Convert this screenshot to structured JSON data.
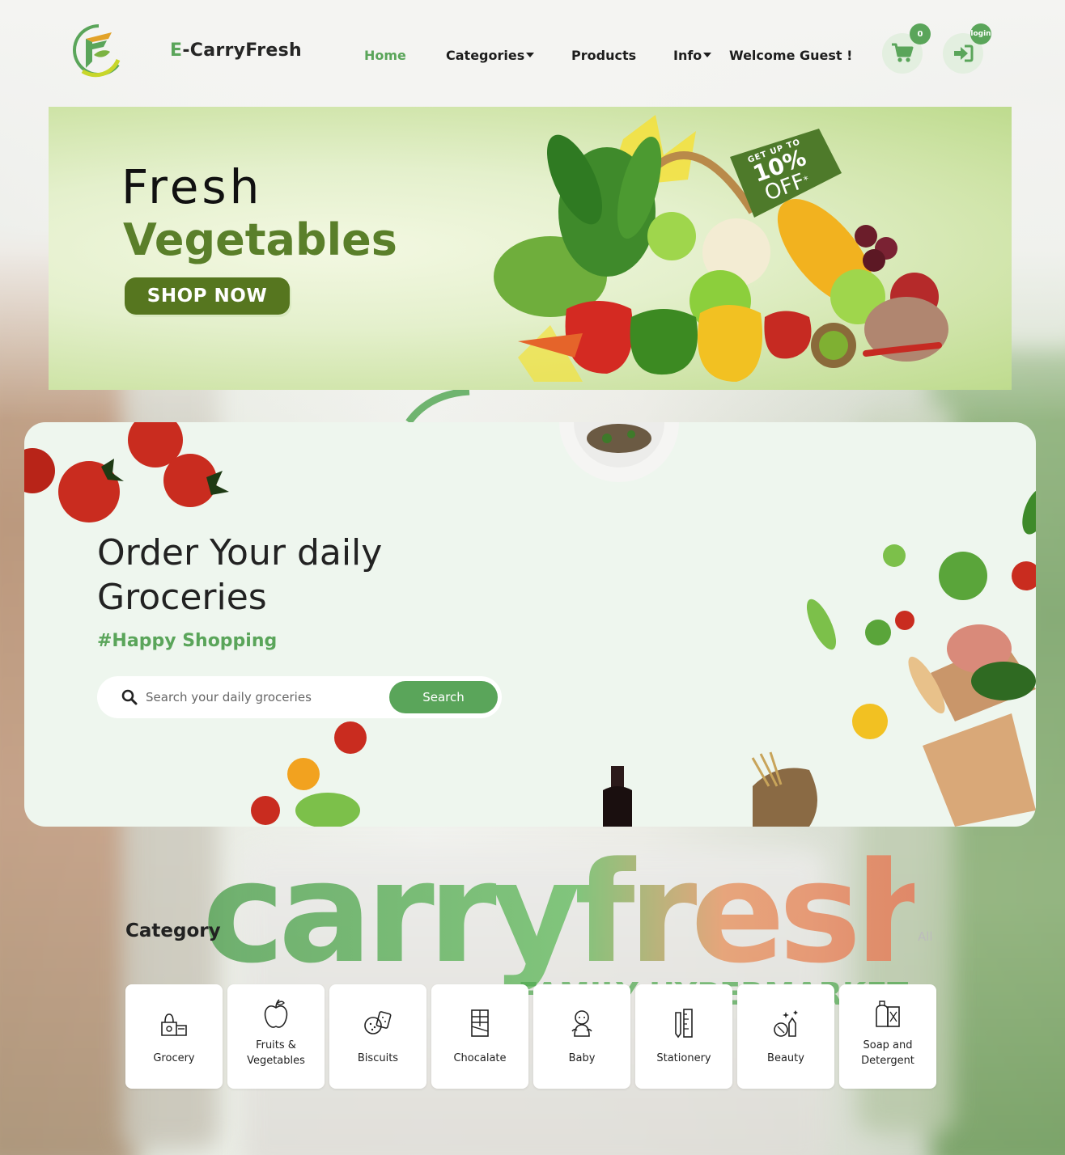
{
  "brand": {
    "prefix": "E",
    "rest": "-CarryFresh"
  },
  "nav": {
    "home": "Home",
    "categories": "Categories",
    "products": "Products",
    "info": "Info",
    "welcome": "Welcome Guest !"
  },
  "cart": {
    "count": "0"
  },
  "login": {
    "label": "login"
  },
  "banner": {
    "line1": "Fresh",
    "line2": "Vegetables",
    "cta": "SHOP NOW",
    "promo_top": "GET UP TO",
    "promo_value": "10%",
    "promo_bottom": "OFF",
    "promo_star": "*"
  },
  "hero": {
    "title": "Order Your daily Groceries",
    "tagline": "#Happy Shopping",
    "search_placeholder": "Search your daily groceries",
    "search_button": "Search"
  },
  "background_logo": {
    "word": "carryfresh",
    "sub": "FAMILY HYPERMARKET"
  },
  "category": {
    "title": "Category",
    "all": "All",
    "items": [
      {
        "label": "Grocery",
        "icon": "grocery-icon"
      },
      {
        "label": "Fruits & Vegetables",
        "icon": "apple-icon"
      },
      {
        "label": "Biscuits",
        "icon": "biscuits-icon"
      },
      {
        "label": "Chocalate",
        "icon": "chocolate-icon"
      },
      {
        "label": "Baby",
        "icon": "baby-icon"
      },
      {
        "label": "Stationery",
        "icon": "stationery-icon"
      },
      {
        "label": "Beauty",
        "icon": "beauty-icon"
      },
      {
        "label": "Soap and Detergent",
        "icon": "detergent-icon"
      }
    ]
  },
  "colors": {
    "accent": "#5aa55a",
    "banner_dark_green": "#56761f",
    "vegetables_green": "#5a7f2a"
  }
}
